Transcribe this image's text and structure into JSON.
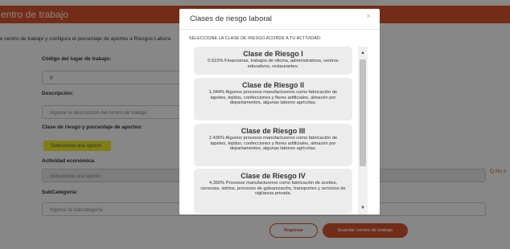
{
  "background": {
    "header_title": "entro de trabajo",
    "intro": "e centro de trabajo y configura el porcentaje de aportes a Riesgos Labora",
    "fields": {
      "codigo": {
        "label": "Código del lugar de trabajo:",
        "value": "0"
      },
      "descripcion": {
        "label": "Descripción:",
        "placeholder": "Ingrese la descripción del centro de trabajo"
      },
      "clase": {
        "label": "Clase de riesgo y porcentaje de aportes:",
        "select_text": "Selecciona una opción"
      },
      "actividad": {
        "label": "Actividad económica",
        "placeholder": "Selecciona una opción",
        "side_link": "Q  No s"
      },
      "subcategoria": {
        "label": "SubCategoria:",
        "placeholder": "Ingrese la subcategoria"
      }
    },
    "buttons": {
      "back": "Regresar",
      "save": "Guardar centro de trabajo"
    },
    "colors": {
      "accent": "#d9532c",
      "highlight": "#f3ef2a"
    }
  },
  "modal": {
    "title": "Clases de riesgo laboral",
    "close_icon": "×",
    "instruction": "SELECCIONE LA CLASE DE RIESGO ACORDE A TU ACTIVIDAD:",
    "cards": [
      {
        "title": "Clase de Riesgo I",
        "desc": "0.522% Financieras, trabajos de oficina, administrativos, centros educativos, restaurantes."
      },
      {
        "title": "Clase de Riesgo II",
        "desc": "1.044% Algunos procesos manufactureros como fabricación de tapetes, tejidos, confecciones y flores artificiales, almacén por departamentos, algunas labores agrícolas."
      },
      {
        "title": "Clase de Riesgo III",
        "desc": "2.436% Algunos procesos manufactureros como fabricación de tapetes, tejidos, confecciones y flores artificiales, almacén por departamentos, algunas labores agrícolas."
      },
      {
        "title": "Clase de Riesgo IV",
        "desc": "4,350% Procesos manufactureros como fabricación de aceites, cervezas, vidrios, procesos de galvanización, transportes y servicios de vigilancia privada."
      }
    ],
    "scroll_up_icon": "▲",
    "scroll_down_icon": "▼"
  }
}
